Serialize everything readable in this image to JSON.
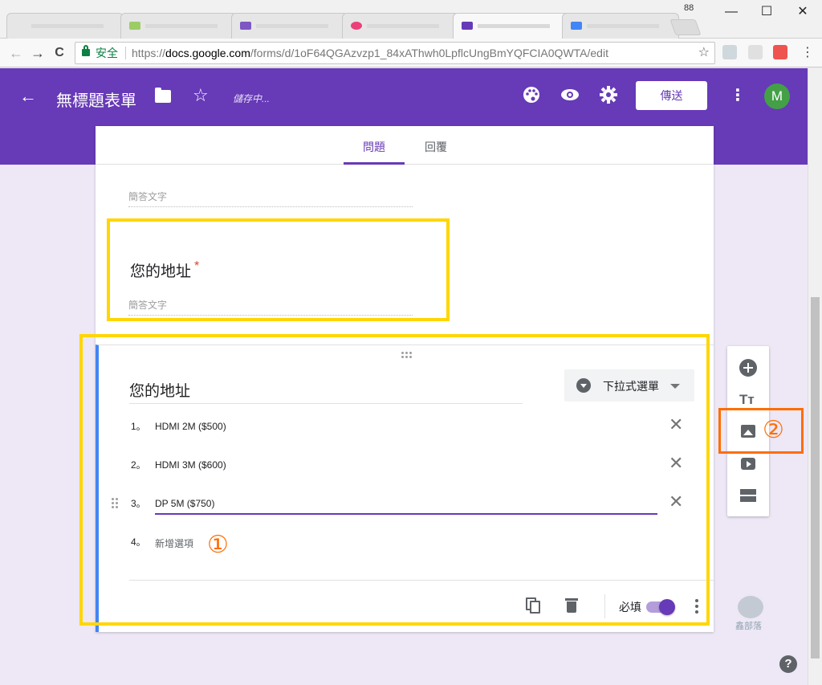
{
  "browser": {
    "tab_count_badge": "88",
    "window_controls": {
      "minimize": "—",
      "maximize": "☐",
      "close": "✕"
    },
    "nav": {
      "back": "←",
      "forward": "→",
      "reload": "C"
    },
    "secure_label": "安全",
    "url_scheme": "https://",
    "url_host": "docs.google.com",
    "url_path": "/forms/d/1oF64QGAzvzp1_84xAThwh0LpflcUngBmYQFCIA0QWTA/edit",
    "bookmark_star": "☆",
    "menu_dots": "⋮"
  },
  "forms_header": {
    "back": "←",
    "title": "無標題表單",
    "star": "☆",
    "saving_status": "儲存中...",
    "send_label": "傳送",
    "more": "⋮",
    "avatar_letter": "M"
  },
  "tabs": {
    "questions": "問題",
    "responses": "回覆"
  },
  "previous_question": {
    "short_answer_placeholder": "簡答文字"
  },
  "address_question": {
    "title": "您的地址",
    "required_mark": "*",
    "short_answer_placeholder": "簡答文字"
  },
  "active_question": {
    "title": "您的地址",
    "type_label": "下拉式選單",
    "options": [
      {
        "num": "1。",
        "value": "HDMI 2M ($500)"
      },
      {
        "num": "2。",
        "value": "HDMI 3M ($600)"
      },
      {
        "num": "3。",
        "value": "DP 5M ($750)"
      }
    ],
    "add_option": {
      "num": "4。",
      "label": "新增選項"
    },
    "required_label": "必填",
    "required_on": true
  },
  "side_toolbar": {
    "text_title_glyph": "Tт"
  },
  "annotations": {
    "step1": "①",
    "step2": "②"
  },
  "watermark_text": "鑫部落",
  "help_glyph": "?",
  "colors": {
    "brand_purple": "#673ab7",
    "highlight_yellow": "#ffd600",
    "highlight_orange": "#ff6d00",
    "active_blue": "#4285f4"
  }
}
